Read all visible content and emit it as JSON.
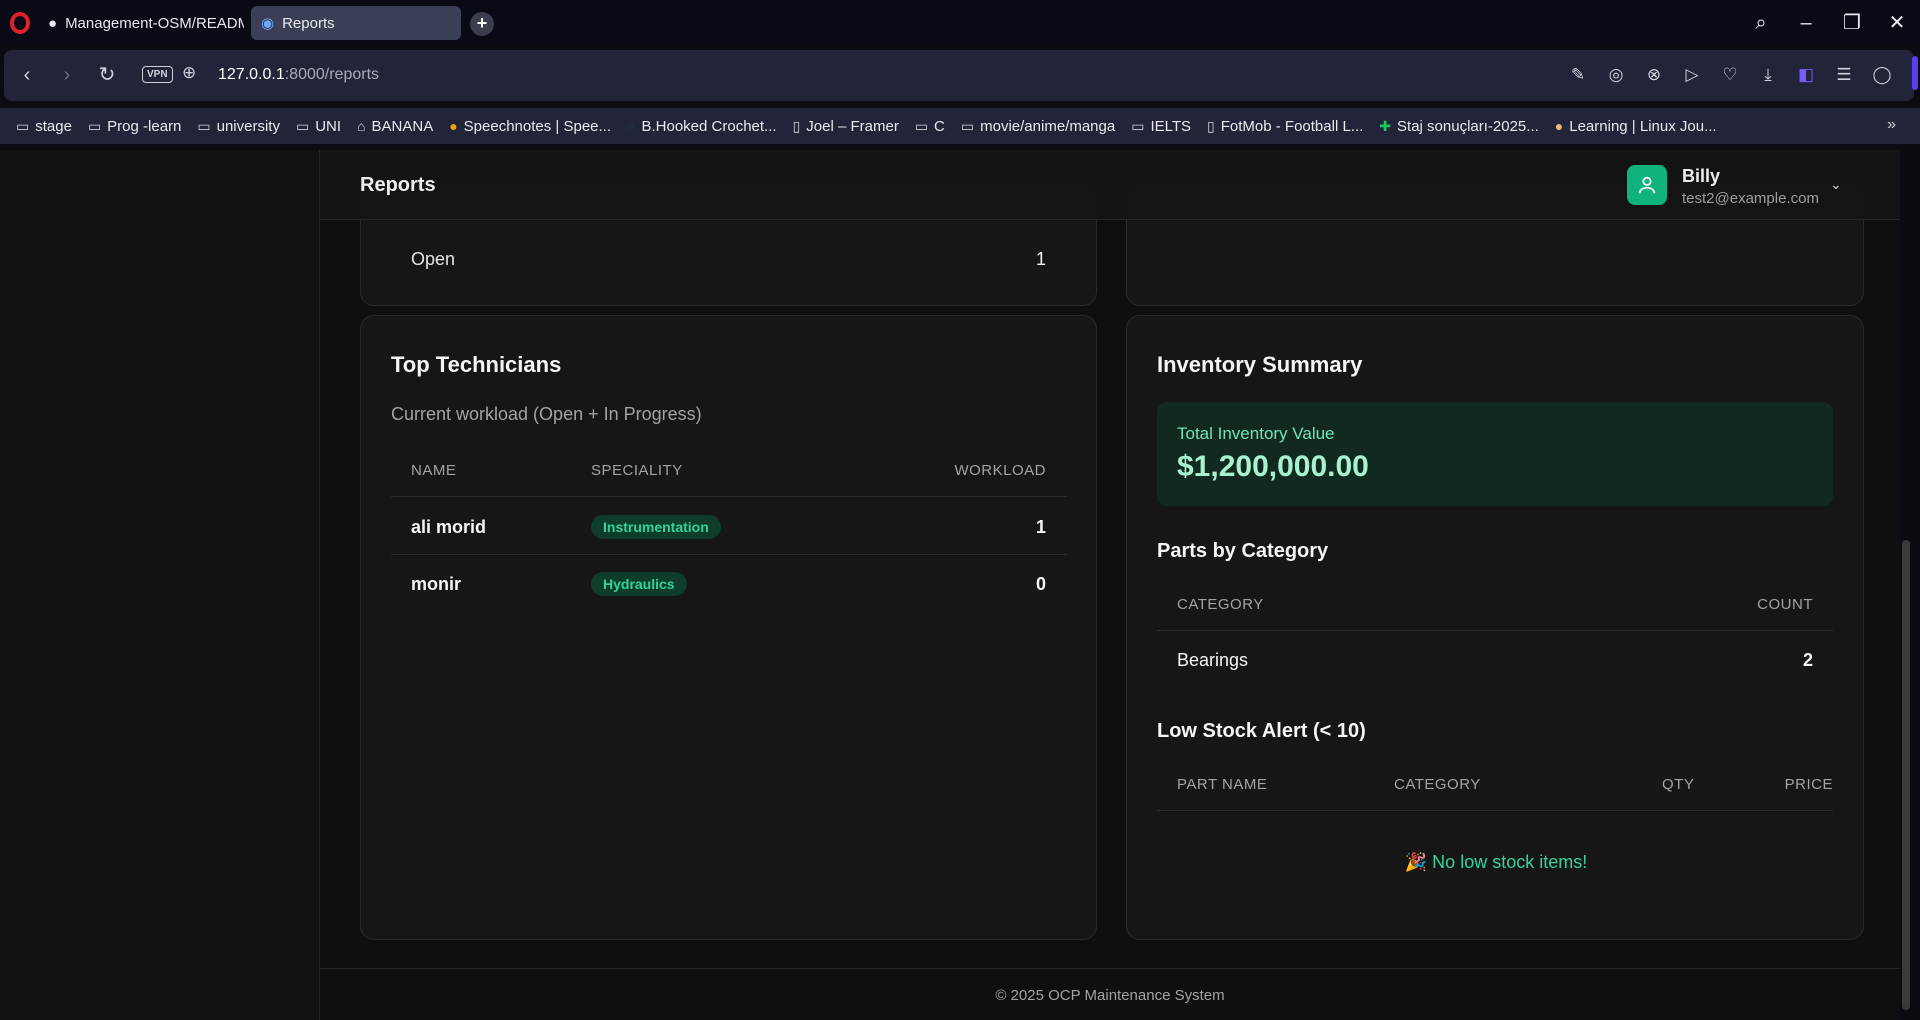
{
  "browser": {
    "tabs": [
      {
        "label": "Management-OSM/READM",
        "icon": "github-icon"
      },
      {
        "label": "Reports",
        "icon": "page-icon"
      }
    ],
    "url_host": "127.0.0.1",
    "url_path": ":8000/reports",
    "vpn_label": "VPN",
    "bookmarks": [
      {
        "label": "stage",
        "icon": "folder-icon"
      },
      {
        "label": "Prog -learn",
        "icon": "folder-icon"
      },
      {
        "label": "university",
        "icon": "folder-icon"
      },
      {
        "label": "UNI",
        "icon": "folder-icon"
      },
      {
        "label": "BANANA",
        "icon": "bank-icon"
      },
      {
        "label": "Speechnotes | Spee...",
        "icon": "mic-icon"
      },
      {
        "label": "B.Hooked Crochet...",
        "icon": "site-icon"
      },
      {
        "label": "Joel – Framer",
        "icon": "page-icon"
      },
      {
        "label": "C",
        "icon": "folder-icon"
      },
      {
        "label": "movie/anime/manga",
        "icon": "folder-icon"
      },
      {
        "label": "IELTS",
        "icon": "folder-icon"
      },
      {
        "label": "FotMob - Football L...",
        "icon": "page-icon"
      },
      {
        "label": "Staj sonuçları-2025...",
        "icon": "sheet-icon"
      },
      {
        "label": "Learning | Linux Jou...",
        "icon": "site-icon"
      }
    ]
  },
  "header": {
    "title": "Reports",
    "user_name": "Billy",
    "user_email": "test2@example.com"
  },
  "status_card": {
    "label": "Open",
    "value": "1"
  },
  "technicians": {
    "title": "Top Technicians",
    "subtitle": "Current workload (Open + In Progress)",
    "columns": [
      "NAME",
      "SPECIALITY",
      "WORKLOAD"
    ],
    "rows": [
      {
        "name": "ali morid",
        "speciality": "Instrumentation",
        "workload": "1"
      },
      {
        "name": "monir",
        "speciality": "Hydraulics",
        "workload": "0"
      }
    ]
  },
  "inventory": {
    "title": "Inventory Summary",
    "total_label": "Total Inventory Value",
    "total_value": "$1,200,000.00",
    "parts_title": "Parts by Category",
    "parts_columns": [
      "CATEGORY",
      "COUNT"
    ],
    "parts_rows": [
      {
        "category": "Bearings",
        "count": "2"
      }
    ],
    "low_stock_title": "Low Stock Alert (< 10)",
    "low_stock_columns": [
      "PART NAME",
      "CATEGORY",
      "QTY",
      "PRICE"
    ],
    "low_stock_empty": "🎉 No low stock items!"
  },
  "footer": {
    "text": "© 2025 OCP Maintenance System"
  },
  "colors": {
    "accent": "#10b981",
    "badge_bg": "#0f3d2c",
    "badge_text": "#34d399"
  }
}
